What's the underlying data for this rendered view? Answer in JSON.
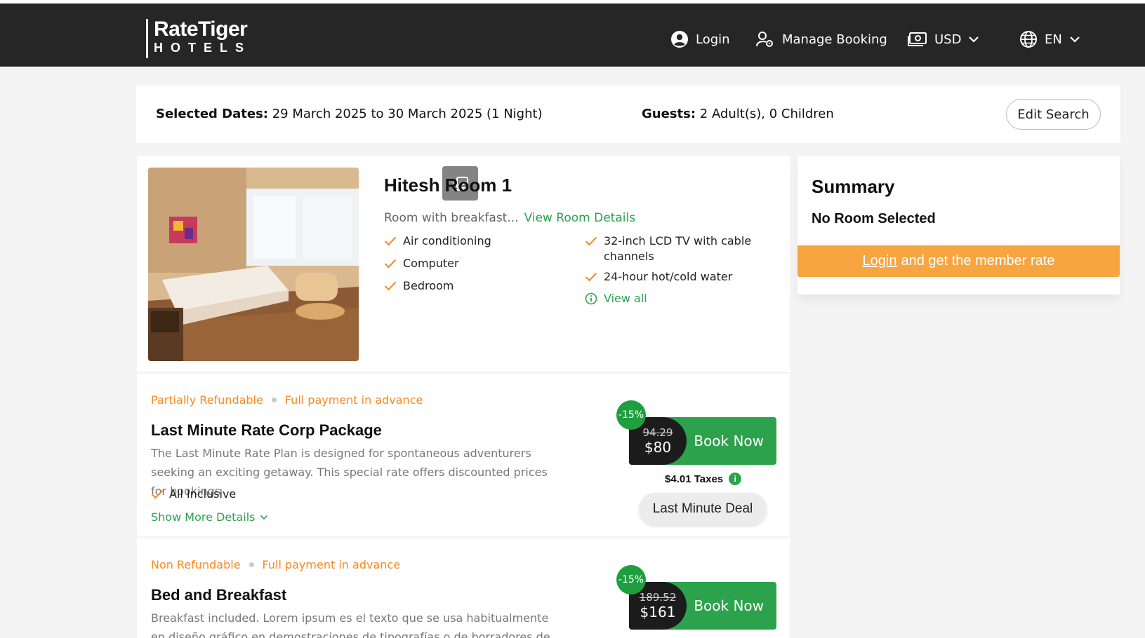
{
  "header": {
    "logo_main": "RateTiger",
    "logo_sub": "HOTELS",
    "login": "Login",
    "manage_booking": "Manage Booking",
    "currency": "USD",
    "language": "EN"
  },
  "search": {
    "dates_label": "Selected Dates:",
    "dates_value": "29 March 2025 to 30 March 2025 (1 Night)",
    "guests_label": "Guests:",
    "guests_value": "2 Adult(s), 0 Children",
    "edit_button": "Edit Search"
  },
  "room": {
    "title": "Hitesh Room 1",
    "description": "Room with breakfast...",
    "details_link": "View Room Details",
    "amenities_left": [
      "Air conditioning",
      "Computer",
      "Bedroom"
    ],
    "amenities_right": [
      "32-inch LCD TV with cable channels",
      "24-hour hot/cold water"
    ],
    "view_all": "View all"
  },
  "summary": {
    "title": "Summary",
    "status": "No Room Selected",
    "login_link": "Login",
    "member_text": "and get the member rate"
  },
  "rates": [
    {
      "refund": "Partially Refundable",
      "payment": "Full payment in advance",
      "title": "Last Minute Rate Corp Package",
      "description": "The Last Minute Rate Plan is designed for spontaneous adventurers seeking an exciting getaway. This special rate offers discounted prices for bookings",
      "inclusion": "All Inclusive",
      "show_more": "Show More Details",
      "discount": "-15%",
      "old_price": "94.29",
      "new_price": "$80",
      "book": "Book Now",
      "taxes": "$4.01 Taxes",
      "deal": "Last Minute Deal"
    },
    {
      "refund": "Non Refundable",
      "payment": "Full payment in advance",
      "title": "Bed and Breakfast",
      "description": "Breakfast included. Lorem ipsum es el texto que se usa habitualmente en diseño gráfico en demostraciones de tipografías o de borradores de diseño.",
      "discount": "-15%",
      "old_price": "189.52",
      "new_price": "$161",
      "book": "Book Now"
    }
  ],
  "colors": {
    "header_bg": "#262626",
    "accent_green": "#2ca24c",
    "accent_orange": "#f58a1f",
    "member_bar": "#f7a540"
  }
}
